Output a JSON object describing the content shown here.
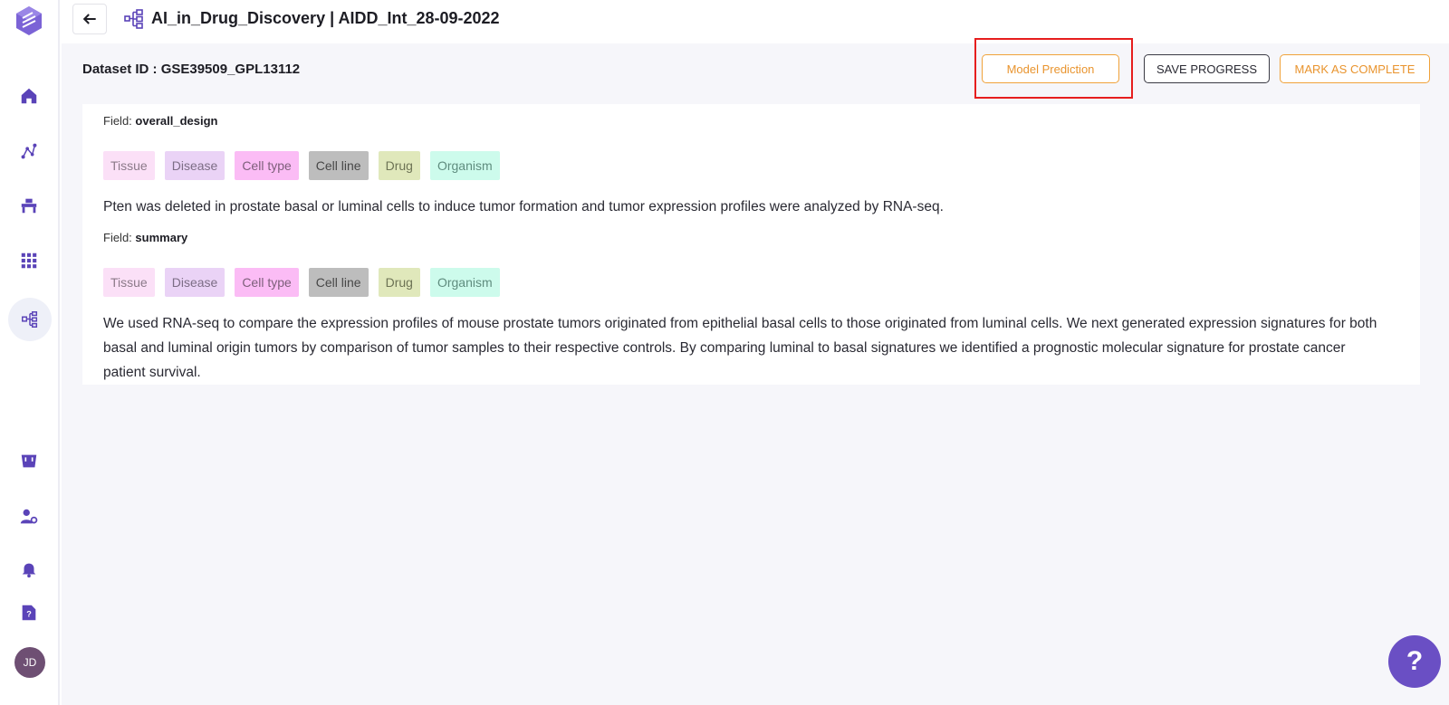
{
  "app": {
    "title": "AI_in_Drug_Discovery | AIDD_Int_28-09-2022",
    "user_initials": "JD"
  },
  "sidebar": {
    "items": [
      {
        "icon": "home-icon"
      },
      {
        "icon": "graph-icon"
      },
      {
        "icon": "workbench-icon"
      },
      {
        "icon": "apps-grid-icon"
      },
      {
        "icon": "curation-icon",
        "active": true
      },
      {
        "icon": "cart-icon"
      },
      {
        "icon": "user-settings-icon"
      },
      {
        "icon": "bell-icon"
      },
      {
        "icon": "help-doc-icon"
      }
    ]
  },
  "header": {
    "dataset_id": "Dataset ID : GSE39509_GPL13112",
    "buttons": {
      "model_prediction": "Model Prediction",
      "save_progress": "SAVE PROGRESS",
      "mark_complete": "MARK AS COMPLETE"
    }
  },
  "fields": [
    {
      "label_prefix": "Field:",
      "name": "overall_design",
      "tags": [
        "Tissue",
        "Disease",
        "Cell type",
        "Cell line",
        "Drug",
        "Organism"
      ],
      "text": "Pten was deleted in prostate basal or luminal cells to induce tumor formation and tumor expression profiles were analyzed by RNA-seq."
    },
    {
      "label_prefix": "Field:",
      "name": "summary",
      "tags": [
        "Tissue",
        "Disease",
        "Cell type",
        "Cell line",
        "Drug",
        "Organism"
      ],
      "text": "We used RNA-seq to compare the expression profiles of mouse prostate tumors originated from epithelial basal cells to those originated from luminal cells. We next generated expression signatures for both basal and luminal origin tumors by comparison of tumor samples to their respective controls. By comparing luminal to basal signatures we identified a prognostic molecular signature for prostate cancer patient survival."
    }
  ],
  "help": {
    "label": "?"
  },
  "colors": {
    "accent": "#6a4fc4",
    "orange": "#f0a23a",
    "highlight": "#e61e1e"
  }
}
